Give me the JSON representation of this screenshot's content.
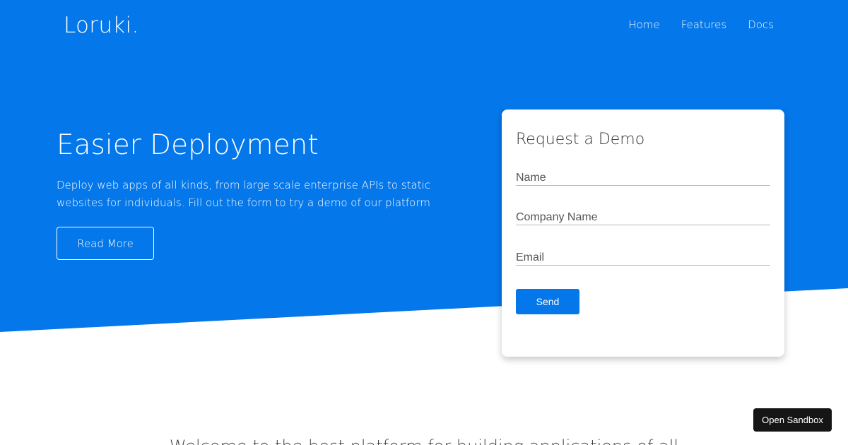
{
  "brand": {
    "logo": "Loruki.",
    "primary_color": "#0477ea"
  },
  "nav": {
    "items": [
      "Home",
      "Features",
      "Docs"
    ]
  },
  "hero": {
    "title": "Easier Deployment",
    "description": "Deploy web apps of all kinds, from large scale enterprise APIs to static websites for individuals. Fill out the form to try a demo of our platform",
    "read_more_label": "Read More"
  },
  "demo_form": {
    "title": "Request a Demo",
    "name_placeholder": "Name",
    "company_placeholder": "Company Name",
    "email_placeholder": "Email",
    "send_label": "Send"
  },
  "welcome": {
    "text": "Welcome to the best platform for building applications of all"
  },
  "sandbox": {
    "label": "Open Sandbox"
  }
}
